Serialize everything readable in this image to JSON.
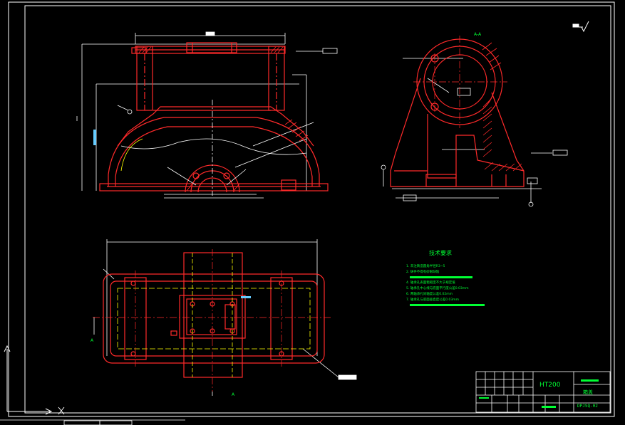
{
  "section_label": "A-A",
  "view_marker_label": "A",
  "tech_req": {
    "title": "技术要求",
    "items": [
      "1. 未注铸造圆角半径R3~5",
      "2. 铸件不得有砂眼缺陷",
      "3. ",
      "4. 轴承孔表面粗糙度不大于规定值",
      "5. 轴承孔中心线与底面平行度公差0.03mm",
      "6. 两轴承孔同轴度公差0.02mm",
      "7. 轴承孔与底面垂直度公差0.03mm"
    ]
  },
  "title_block": {
    "material": "HT200",
    "part_name": "箱盖",
    "drawing_no": "DPJSQ-02"
  },
  "colors": {
    "background": "#000000",
    "border": "#ffffff",
    "outline": "#ff2a2a",
    "center_line": "#ff2a2a",
    "dimension": "#ffffff",
    "hidden": "#ffff00",
    "text_green": "#00ff33",
    "highlight_cyan": "#66ccff"
  },
  "icons": {
    "roughness": "roughness-symbol-icon",
    "ucs": "ucs-axis-icon"
  }
}
